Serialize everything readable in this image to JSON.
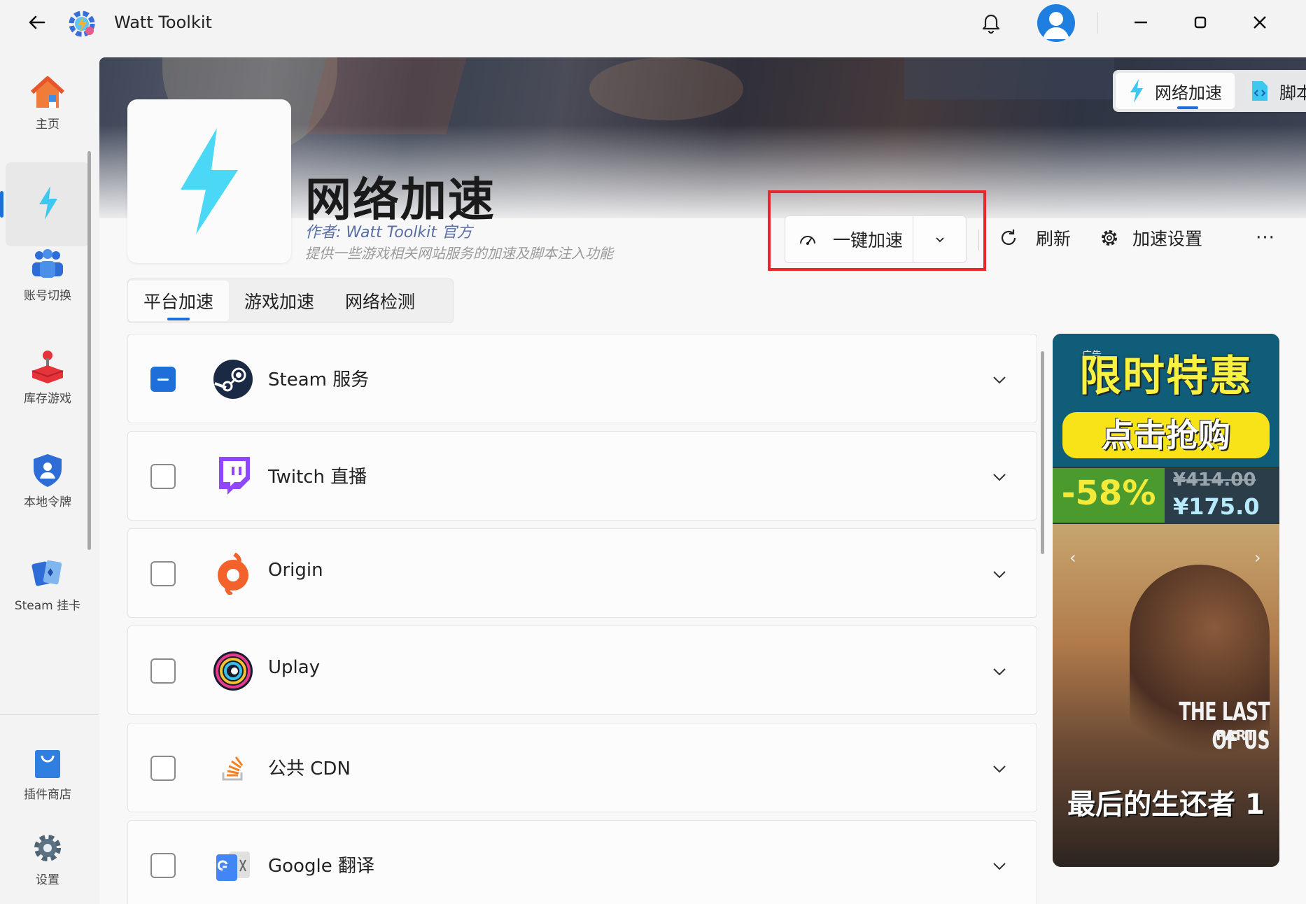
{
  "app": {
    "title": "Watt Toolkit"
  },
  "sidebar": {
    "items": [
      {
        "label": "主页"
      },
      {
        "label": ""
      },
      {
        "label": "账号切换"
      },
      {
        "label": "库存游戏"
      },
      {
        "label": "本地令牌"
      },
      {
        "label": "Steam 挂卡"
      },
      {
        "label": "插件商店"
      },
      {
        "label": "设置"
      }
    ]
  },
  "mode_switch": {
    "network": "网络加速",
    "script": "脚本配置"
  },
  "plugin": {
    "title": "网络加速",
    "author": "作者:  Watt Toolkit  官方",
    "description": "提供一些游戏相关网站服务的加速及脚本注入功能"
  },
  "actions": {
    "one_click": "一键加速",
    "refresh": "刷新",
    "settings": "加速设置",
    "more": "···"
  },
  "tabs": [
    "平台加速",
    "游戏加速",
    "网络检测"
  ],
  "list": [
    {
      "label": "Steam 服务",
      "state": "mixed"
    },
    {
      "label": "Twitch 直播",
      "state": "unchecked"
    },
    {
      "label": "Origin",
      "state": "unchecked"
    },
    {
      "label": "Uplay",
      "state": "unchecked"
    },
    {
      "label": "公共 CDN",
      "state": "unchecked"
    },
    {
      "label": "Google 翻译",
      "state": "unchecked"
    }
  ],
  "ad": {
    "headline": "限时特惠",
    "cta": "点击抢购",
    "discount": "-58%",
    "old_price": "¥414.00",
    "new_price": "¥175.0",
    "logo_line1": "THE LAST OF US",
    "logo_line2": "PART I",
    "caption": "最后的生还者 1",
    "prev": "‹",
    "next": "›",
    "corner": "广告"
  },
  "colors": {
    "accent": "#1e6fd9",
    "highlight": "#e8262b",
    "plugin_icon": "#4ad8f6"
  }
}
